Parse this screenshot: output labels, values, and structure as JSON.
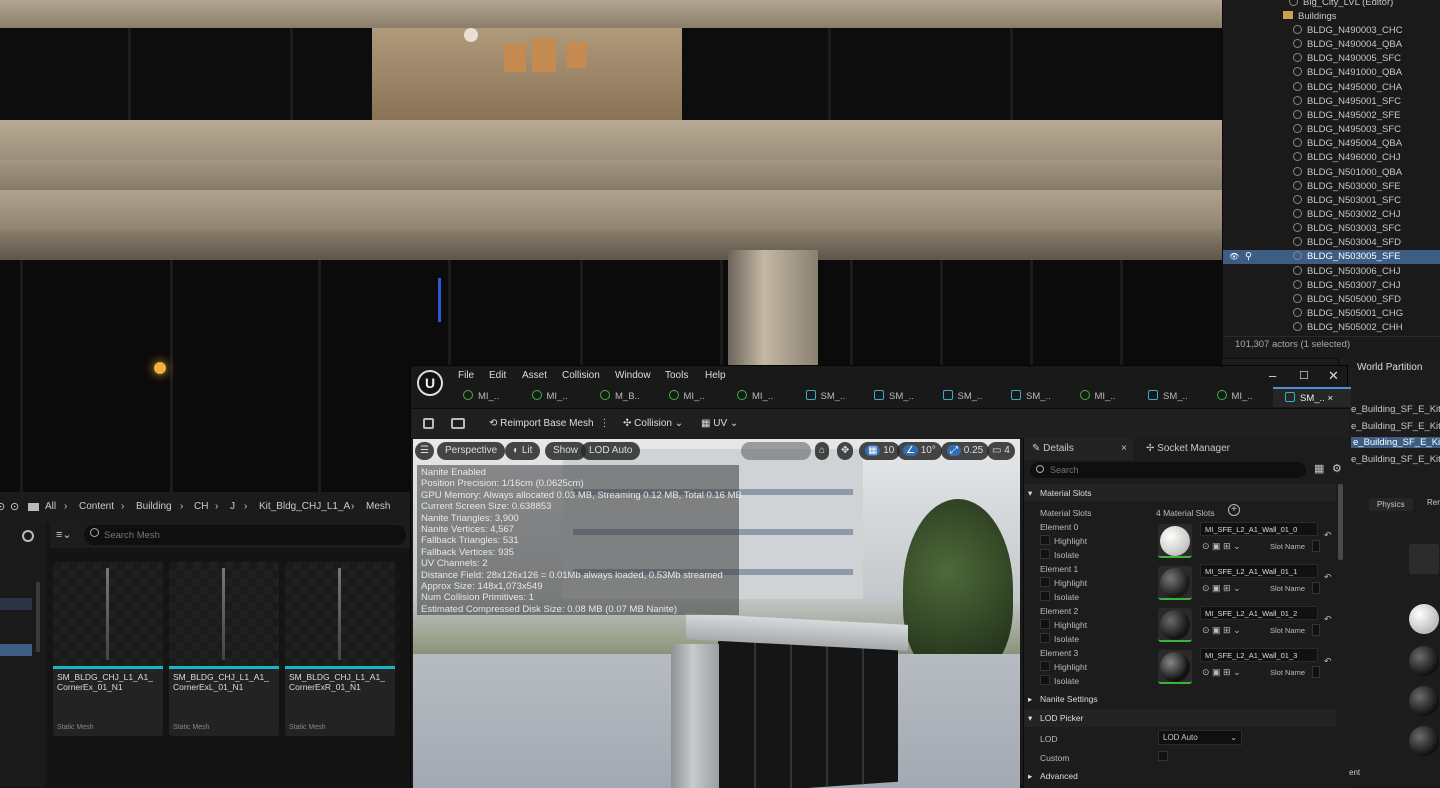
{
  "outliner": {
    "level": "Big_City_LVL (Editor)",
    "folder": "Buildings",
    "items": [
      "BLDG_N490003_CHC",
      "BLDG_N490004_QBA",
      "BLDG_N490005_SFC",
      "BLDG_N491000_QBA",
      "BLDG_N495000_CHA",
      "BLDG_N495001_SFC",
      "BLDG_N495002_SFE",
      "BLDG_N495003_SFC",
      "BLDG_N495004_QBA",
      "BLDG_N496000_CHJ",
      "BLDG_N501000_QBA",
      "BLDG_N503000_SFE",
      "BLDG_N503001_SFC",
      "BLDG_N503002_CHJ",
      "BLDG_N503003_SFC",
      "BLDG_N503004_SFD",
      "BLDG_N503005_SFE",
      "BLDG_N503006_CHJ",
      "BLDG_N503007_CHJ",
      "BLDG_N505000_SFD",
      "BLDG_N505001_CHG",
      "BLDG_N505002_CHH"
    ],
    "selected_index": 16,
    "footer": "101,307 actors (1 selected)"
  },
  "right_panel": {
    "title": "World Partition",
    "items": [
      "e_Building_SF_E_Kit_E",
      "e_Building_SF_E_Kit_E",
      "e_Building_SF_E_Kit_E",
      "e_Building_SF_E_Kit_E"
    ],
    "highlight_index": 2,
    "physics_label": "Physics",
    "ren_label": "Ren",
    "bottom_label": "ent"
  },
  "content_browser": {
    "breadcrumb": [
      "All",
      "Content",
      "Building",
      "CH",
      "J",
      "Kit_Bldg_CHJ_L1_A",
      "Mesh"
    ],
    "search_placeholder": "Search Mesh",
    "assets": [
      {
        "name": "SM_BLDG_CHJ_L1_A1_ CornerEx_01_N1",
        "type": "Static Mesh"
      },
      {
        "name": "SM_BLDG_CHJ_L1_A1_ CornerExL_01_N1",
        "type": "Static Mesh"
      },
      {
        "name": "SM_BLDG_CHJ_L1_A1_ CornerExR_01_N1",
        "type": "Static Mesh"
      }
    ]
  },
  "editor": {
    "menus": [
      "File",
      "Edit",
      "Asset",
      "Collision",
      "Window",
      "Tools",
      "Help"
    ],
    "tabs": [
      "MI_..",
      "MI_..",
      "M_B..",
      "MI_..",
      "MI_..",
      "SM_..",
      "SM_..",
      "SM_..",
      "SM_..",
      "MI_..",
      "SM_..",
      "MI_..",
      "SM_.."
    ],
    "active_tab": 12,
    "toolbar": {
      "reimport": "Reimport Base Mesh",
      "collision": "Collision",
      "uv": "UV"
    },
    "viewport": {
      "perspective": "Perspective",
      "lit": "Lit",
      "show": "Show",
      "lod": "LOD Auto",
      "grid": "10",
      "angle": "10°",
      "scale": "0.25",
      "cam": "4",
      "stats": [
        "Nanite Enabled",
        "Position Precision: 1/16cm (0.0625cm)",
        "GPU Memory: Always allocated 0.03 MB, Streaming 0.12 MB, Total 0.16 MB",
        "Current Screen Size: 0.638853",
        "Nanite Triangles:  3,900",
        "Nanite Vertices:  4,567",
        "Fallback Triangles:  531",
        "Fallback Vertices:  935",
        "UV Channels:  2",
        "Distance Field:  28x126x126 = 0.01Mb always loaded, 0.53Mb streamed",
        "Approx Size: 148x1,073x549",
        "Num Collision Primitives:  1",
        "Estimated Compressed Disk Size: 0.08 MB (0.07 MB Nanite)"
      ]
    },
    "details": {
      "tab1": "Details",
      "tab2": "Socket Manager",
      "search_placeholder": "Search",
      "material_slots_header": "Material Slots",
      "material_slots_label": "Material Slots",
      "material_slots_count": "4 Material Slots",
      "highlight": "Highlight",
      "isolate": "Isolate",
      "slot_name": "Slot Name",
      "elements": [
        {
          "label": "Element 0",
          "material": "MI_SFE_L2_A1_Wall_01_0"
        },
        {
          "label": "Element 1",
          "material": "MI_SFE_L2_A1_Wall_01_1"
        },
        {
          "label": "Element 2",
          "material": "MI_SFE_L2_A1_Wall_01_2"
        },
        {
          "label": "Element 3",
          "material": "MI_SFE_L2_A1_Wall_01_3"
        }
      ],
      "nanite": "Nanite Settings",
      "lod_picker": "LOD Picker",
      "lod_label": "LOD",
      "lod_value": "LOD Auto",
      "custom": "Custom",
      "advanced": "Advanced"
    }
  }
}
